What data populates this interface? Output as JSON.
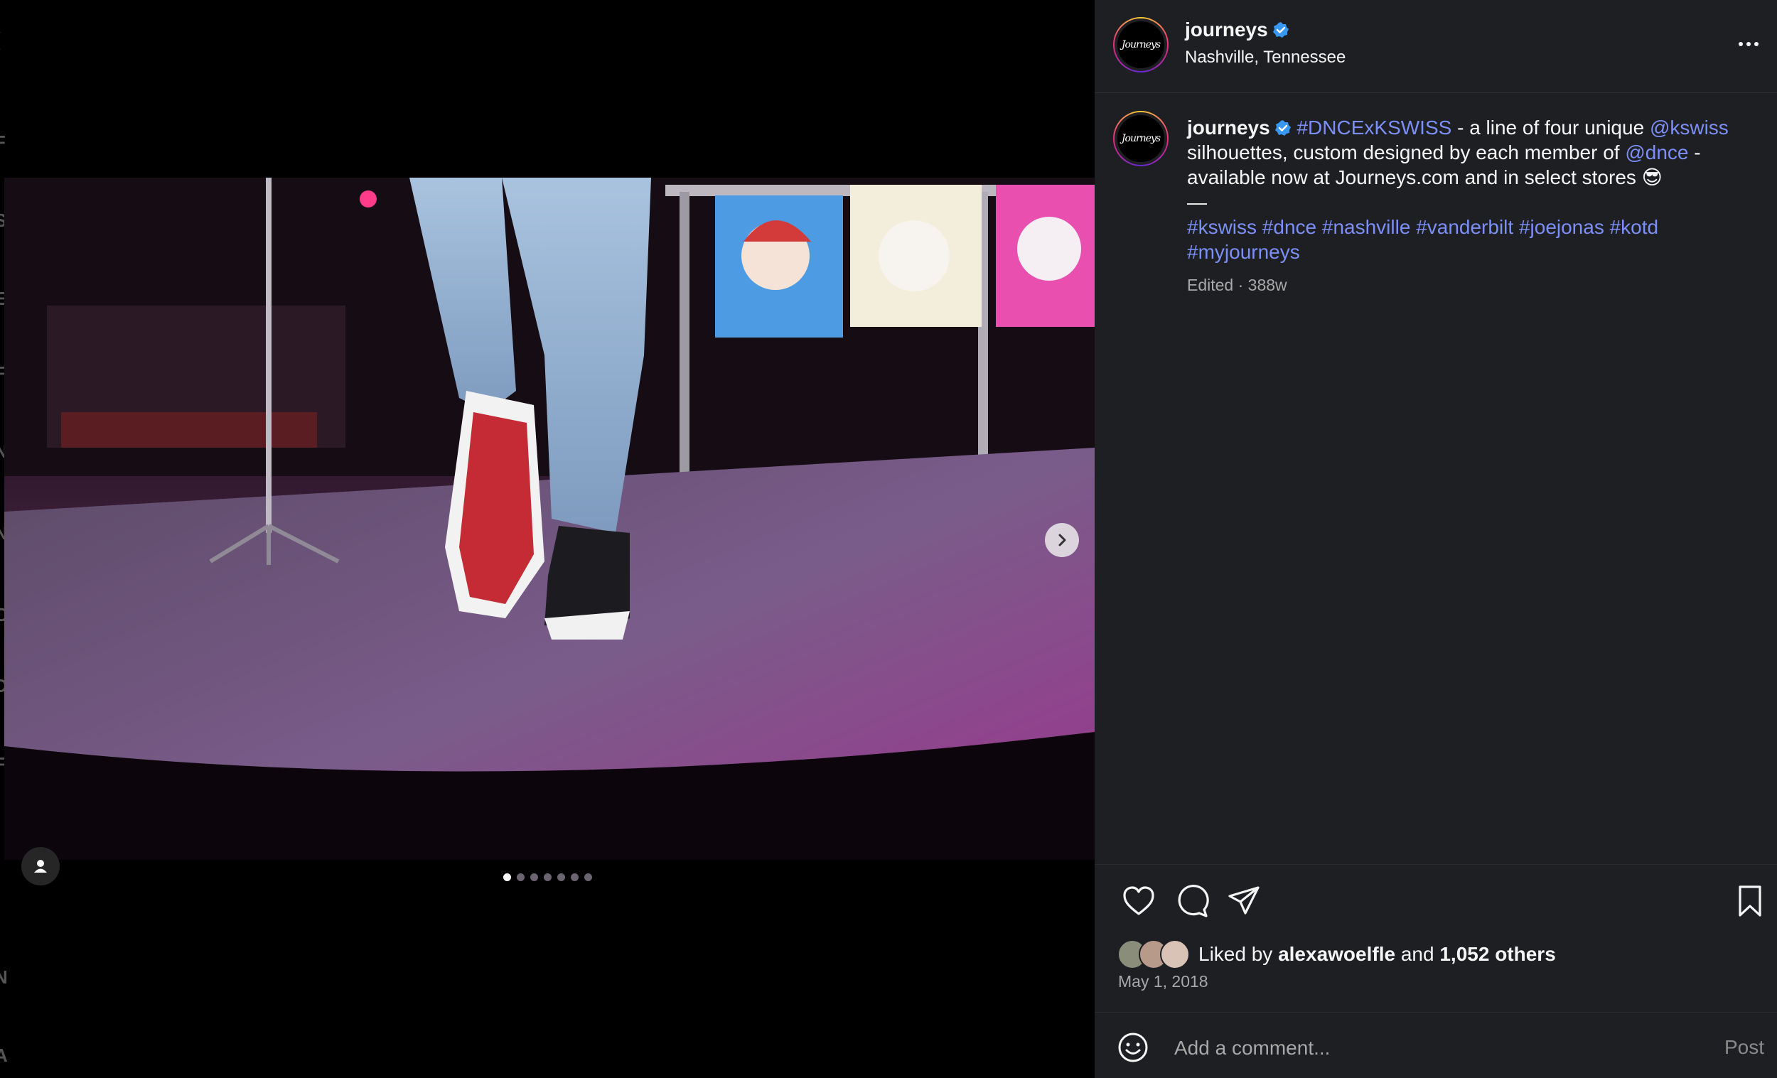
{
  "left_edge_letters": [
    "(",
    "F",
    "S",
    "E",
    "F",
    "N",
    "N",
    "C",
    "D",
    "F",
    "N",
    "A"
  ],
  "media": {
    "carousel": {
      "total_slides": 7,
      "active_index": 0
    }
  },
  "post": {
    "username": "journeys",
    "verified": true,
    "location": "Nashville, Tennessee",
    "avatar_text": "Journeys",
    "caption": {
      "username": "journeys",
      "segments": [
        {
          "text": "#DNCExKSWISS",
          "link": true
        },
        {
          "text": " - a line of four unique ",
          "link": false
        },
        {
          "text": "@kswiss",
          "link": true
        },
        {
          "text": " silhouettes, custom designed by each member of ",
          "link": false
        },
        {
          "text": "@dnce",
          "link": true
        },
        {
          "text": " - available now at Journeys.com and in select stores 😎",
          "link": false
        }
      ],
      "dash": "—",
      "hashtags": [
        "#kswiss",
        "#dnce",
        "#nashville",
        "#vanderbilt",
        "#joejonas",
        "#kotd",
        "#myjourneys"
      ],
      "meta": "Edited · 388w"
    },
    "likes": {
      "prefix": "Liked by",
      "user": "alexawoelfle",
      "and": "and",
      "others": "1,052 others"
    },
    "date": "May 1, 2018",
    "comment": {
      "placeholder": "Add a comment...",
      "post_label": "Post"
    }
  },
  "icons": {
    "like": "heart-icon",
    "comment": "comment-icon",
    "share": "share-icon",
    "save": "bookmark-icon",
    "emoji": "emoji-icon",
    "more": "more-icon",
    "next": "chevron-right-icon",
    "tagged": "user-icon",
    "verified": "verified-badge-icon"
  },
  "colors": {
    "panel_bg": "#1e1f23",
    "link": "#7c8ff7",
    "verified": "#3897f0",
    "muted": "#a8a8a8"
  }
}
